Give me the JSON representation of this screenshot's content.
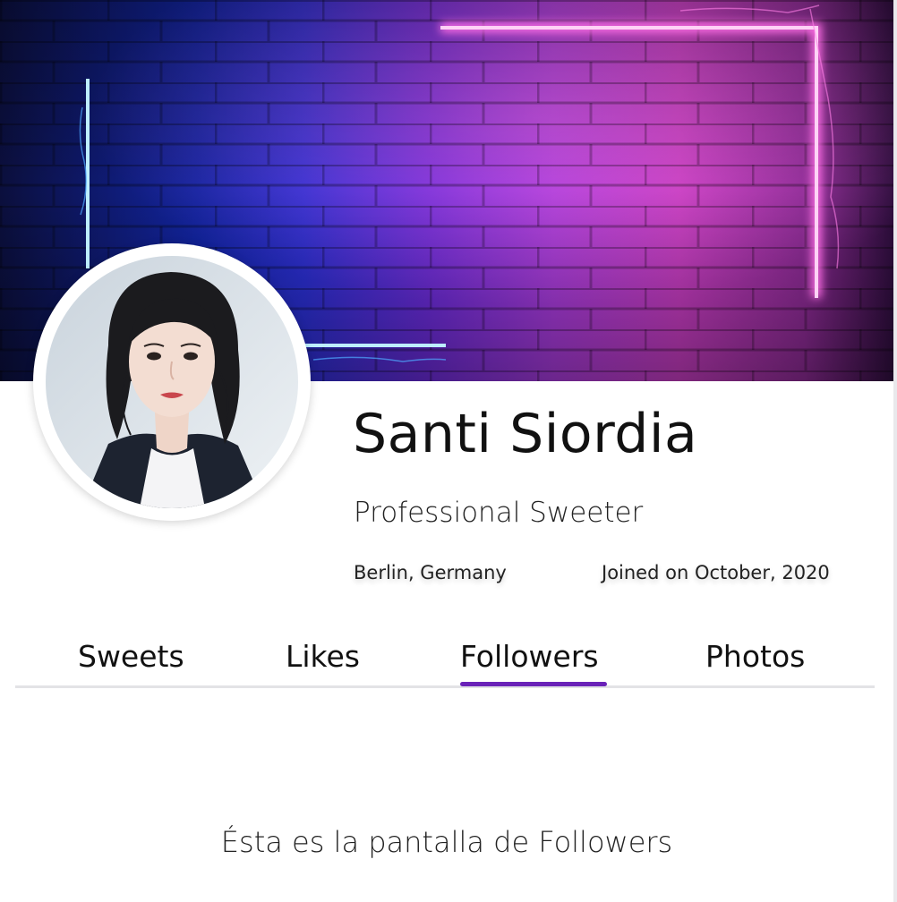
{
  "profile": {
    "name": "Santi Siordia",
    "title": "Professional Sweeter",
    "location": "Berlin, Germany",
    "joined": "Joined on October, 2020"
  },
  "tabs": [
    {
      "label": "Sweets"
    },
    {
      "label": "Likes"
    },
    {
      "label": "Followers",
      "active": true
    },
    {
      "label": "Photos"
    }
  ],
  "content": {
    "message": "Ésta es la pantalla de Followers"
  },
  "colors": {
    "accent": "#6a22b8",
    "neon_blue": "#4fc3ff",
    "neon_pink": "#ff5ce1"
  }
}
